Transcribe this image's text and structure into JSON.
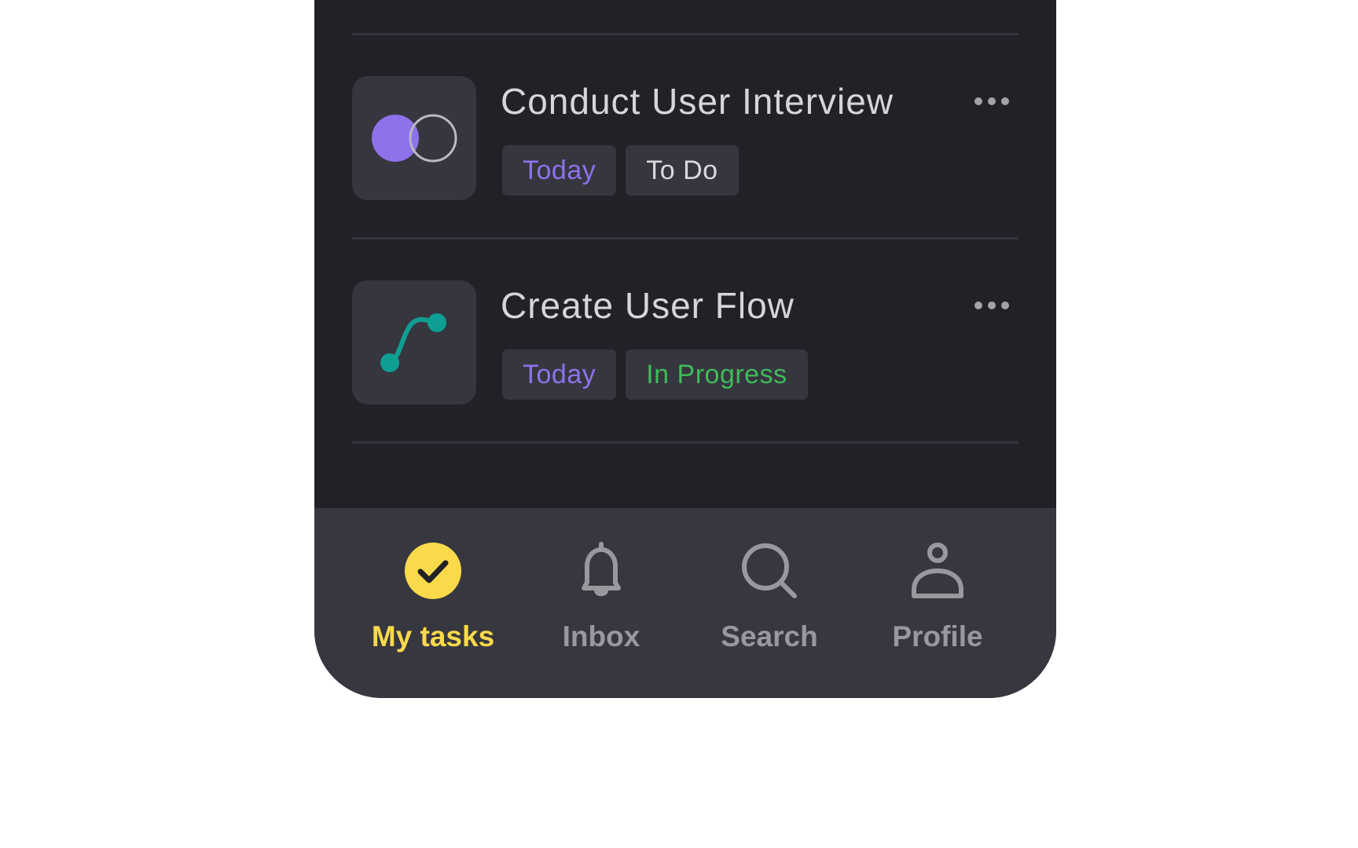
{
  "colors": {
    "screen_bg": "#212128",
    "card_bg": "#36363f",
    "nav_bg": "#37373f",
    "accent_purple": "#8e72ea",
    "accent_green": "#3fba5b",
    "accent_teal": "#0f9e93",
    "accent_yellow": "#fada4a",
    "muted": "#98989e"
  },
  "tasks": [
    {
      "title": "Conduct User Interview",
      "icon": "overlapping-circles-icon",
      "due_tag": "Today",
      "status_tag": "To Do",
      "more_icon": "more-dots-icon"
    },
    {
      "title": "Create User Flow",
      "icon": "flow-curve-icon",
      "due_tag": "Today",
      "status_tag": "In Progress",
      "more_icon": "more-dots-icon"
    }
  ],
  "nav": {
    "items": [
      {
        "label": "My tasks",
        "icon": "check-circle-icon",
        "active": true
      },
      {
        "label": "Inbox",
        "icon": "bell-icon",
        "active": false
      },
      {
        "label": "Search",
        "icon": "search-icon",
        "active": false
      },
      {
        "label": "Profile",
        "icon": "person-icon",
        "active": false
      }
    ]
  }
}
